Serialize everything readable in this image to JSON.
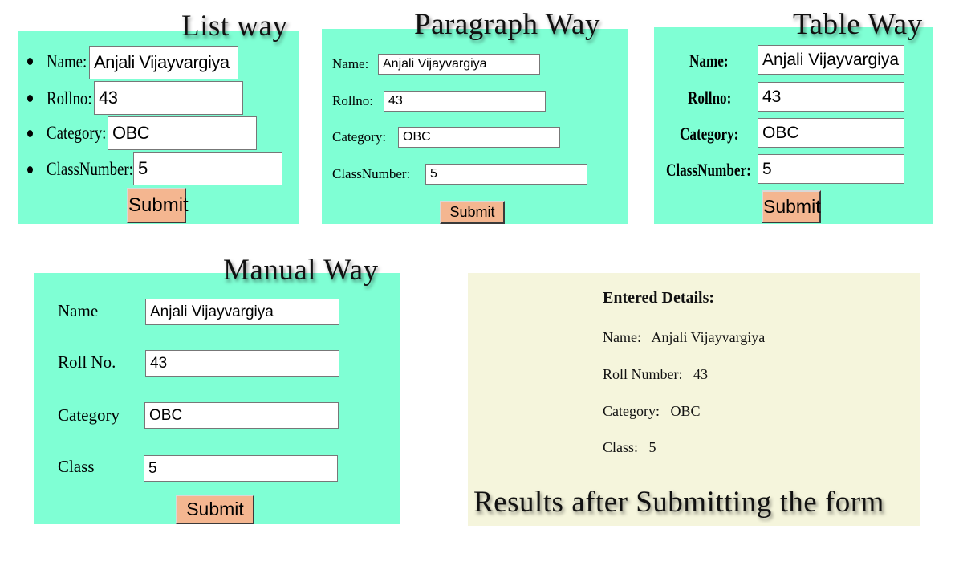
{
  "captions": {
    "list": "List way",
    "paragraph": "Paragraph Way",
    "table": "Table Way",
    "manual": "Manual Way",
    "results": "Results after Submitting the form"
  },
  "list_form": {
    "labels": [
      "Name:",
      "Rollno:",
      "Category:",
      "ClassNumber:"
    ],
    "values": [
      "Anjali Vijayvargiya",
      "43",
      "OBC",
      "5"
    ],
    "submit": "Submit"
  },
  "paragraph_form": {
    "labels": [
      "Name:",
      "Rollno:",
      "Category:",
      "ClassNumber:"
    ],
    "values": [
      "Anjali Vijayvargiya",
      "43",
      "OBC",
      "5"
    ],
    "submit": "Submit"
  },
  "table_form": {
    "labels": [
      "Name:",
      "Rollno:",
      "Category:",
      "ClassNumber:"
    ],
    "values": [
      "Anjali Vijayvargiya",
      "43",
      "OBC",
      "5"
    ],
    "submit": "Submit"
  },
  "manual_form": {
    "labels": [
      "Name",
      "Roll No.",
      "Category",
      "Class"
    ],
    "values": [
      "Anjali Vijayvargiya",
      "43",
      "OBC",
      "5"
    ],
    "submit": "Submit"
  },
  "results": {
    "heading": "Entered Details:",
    "rows": [
      {
        "label": "Name:",
        "value": "Anjali Vijayvargiya"
      },
      {
        "label": "Roll Number:",
        "value": "43"
      },
      {
        "label": "Category:",
        "value": "OBC"
      },
      {
        "label": "Class:",
        "value": "5"
      }
    ]
  },
  "colors": {
    "form_background": "#7fffd4",
    "results_background": "#f5f5dc",
    "submit_button": "#f4b690"
  }
}
